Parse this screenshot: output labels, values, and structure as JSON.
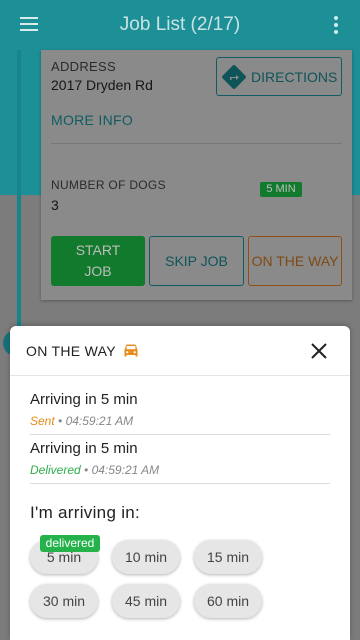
{
  "app_bar": {
    "title": "Job List (2/17)"
  },
  "job_card": {
    "address_label": "ADDRESS",
    "address_value": "2017 Dryden Rd",
    "directions_label": "DIRECTIONS",
    "more_info_label": "MORE INFO",
    "dogs_label": "NUMBER OF DOGS",
    "dogs_value": "3",
    "start_job_label": "START JOB",
    "skip_job_label": "SKIP JOB",
    "on_the_way_label": "ON THE WAY",
    "eta_badge": "5 MIN"
  },
  "sheet": {
    "title": "ON THE WAY",
    "messages": [
      {
        "text": "Arriving in 5 min",
        "status": "Sent",
        "time": "04:59:21 AM"
      },
      {
        "text": "Arriving in 5 min",
        "status": "Delivered",
        "time": "04:59:21 AM"
      }
    ],
    "arriving_label": "I'm arriving in:",
    "delivered_badge": "delivered",
    "time_options": [
      "5 min",
      "10 min",
      "15 min",
      "30 min",
      "45 min",
      "60 min"
    ]
  },
  "colors": {
    "teal": "#1d8f96",
    "green": "#26b24a",
    "orange": "#e78b1a"
  },
  "icons": [
    "menu-icon",
    "more-vert-icon",
    "directions-icon",
    "car-icon",
    "close-icon"
  ]
}
